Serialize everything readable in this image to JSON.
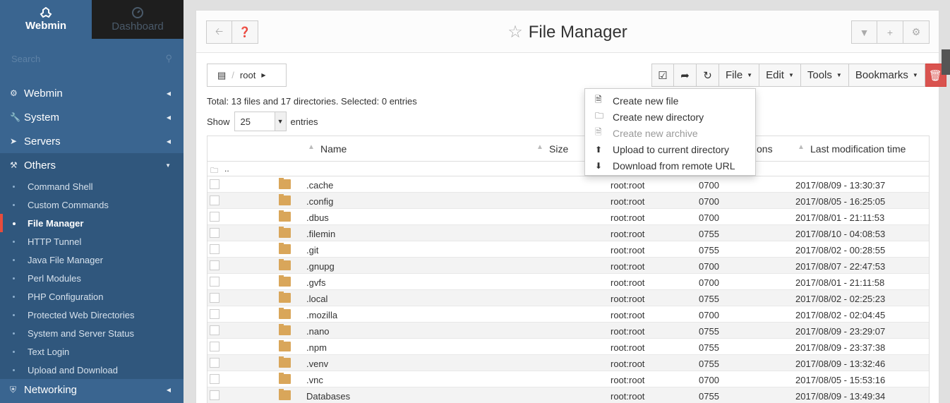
{
  "sidebar": {
    "brand": {
      "label": "Webmin",
      "icon": "webmin-logo-icon"
    },
    "dashboard": {
      "label": "Dashboard",
      "icon": "dashboard-gauge-icon"
    },
    "search_placeholder": "Search",
    "categories": [
      {
        "label": "Webmin",
        "icon": "gear-icon"
      },
      {
        "label": "System",
        "icon": "wrench-icon"
      },
      {
        "label": "Servers",
        "icon": "rocket-icon"
      },
      {
        "label": "Others",
        "icon": "gavel-icon"
      }
    ],
    "others_items": [
      "Command Shell",
      "Custom Commands",
      "File Manager",
      "HTTP Tunnel",
      "Java File Manager",
      "Perl Modules",
      "PHP Configuration",
      "Protected Web Directories",
      "System and Server Status",
      "Text Login",
      "Upload and Download"
    ],
    "networking": {
      "label": "Networking",
      "icon": "shield-icon"
    }
  },
  "header": {
    "title": "File Manager"
  },
  "breadcrumb": {
    "path": "root"
  },
  "toolbar": {
    "file": "File",
    "edit": "Edit",
    "tools": "Tools",
    "bookmarks": "Bookmarks"
  },
  "summary": "Total: 13 files and 17 directories. Selected: 0 entries",
  "show": {
    "label_before": "Show",
    "value": "25",
    "label_after": "entries"
  },
  "table": {
    "headers": {
      "name": "Name",
      "size": "Size",
      "permissions": "ons",
      "modified": "Last modification time"
    },
    "parent": "..",
    "rows": [
      {
        "name": ".cache",
        "owner": "root:root",
        "perm": "0700",
        "mtime": "2017/08/09 - 13:30:37"
      },
      {
        "name": ".config",
        "owner": "root:root",
        "perm": "0700",
        "mtime": "2017/08/05 - 16:25:05"
      },
      {
        "name": ".dbus",
        "owner": "root:root",
        "perm": "0700",
        "mtime": "2017/08/01 - 21:11:53"
      },
      {
        "name": ".filemin",
        "owner": "root:root",
        "perm": "0755",
        "mtime": "2017/08/10 - 04:08:53"
      },
      {
        "name": ".git",
        "owner": "root:root",
        "perm": "0755",
        "mtime": "2017/08/02 - 00:28:55"
      },
      {
        "name": ".gnupg",
        "owner": "root:root",
        "perm": "0700",
        "mtime": "2017/08/07 - 22:47:53"
      },
      {
        "name": ".gvfs",
        "owner": "root:root",
        "perm": "0700",
        "mtime": "2017/08/01 - 21:11:58"
      },
      {
        "name": ".local",
        "owner": "root:root",
        "perm": "0755",
        "mtime": "2017/08/02 - 02:25:23"
      },
      {
        "name": ".mozilla",
        "owner": "root:root",
        "perm": "0700",
        "mtime": "2017/08/02 - 02:04:45"
      },
      {
        "name": ".nano",
        "owner": "root:root",
        "perm": "0755",
        "mtime": "2017/08/09 - 23:29:07"
      },
      {
        "name": ".npm",
        "owner": "root:root",
        "perm": "0755",
        "mtime": "2017/08/09 - 23:37:38"
      },
      {
        "name": ".venv",
        "owner": "root:root",
        "perm": "0755",
        "mtime": "2017/08/09 - 13:32:46"
      },
      {
        "name": ".vnc",
        "owner": "root:root",
        "perm": "0700",
        "mtime": "2017/08/05 - 15:53:16"
      },
      {
        "name": "Databases",
        "owner": "root:root",
        "perm": "0755",
        "mtime": "2017/08/09 - 13:49:34"
      }
    ]
  },
  "file_menu": [
    {
      "label": "Create new file",
      "icon": "file-icon",
      "disabled": false
    },
    {
      "label": "Create new directory",
      "icon": "folder-open-icon",
      "disabled": false
    },
    {
      "label": "Create new archive",
      "icon": "archive-file-icon",
      "disabled": true
    },
    {
      "label": "Upload to current directory",
      "icon": "upload-icon",
      "disabled": false
    },
    {
      "label": "Download from remote URL",
      "icon": "download-icon",
      "disabled": false
    }
  ]
}
